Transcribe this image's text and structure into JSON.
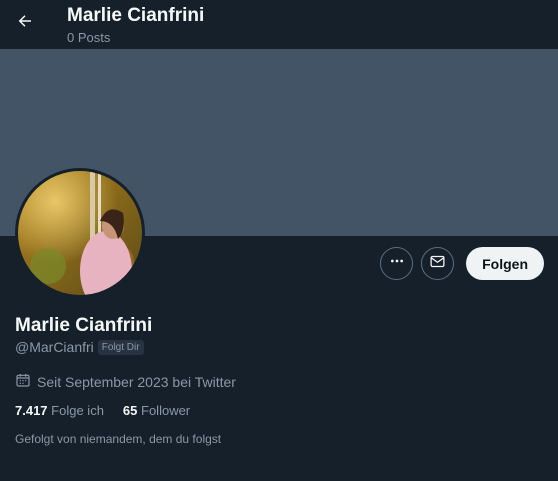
{
  "header": {
    "back_icon": "arrow-left-icon",
    "title": "Marlie Cianfrini",
    "subtitle": "0 Posts"
  },
  "colors": {
    "background": "#15202b",
    "banner": "#425466",
    "text_primary": "#f7f9f9",
    "text_secondary": "#8b98a5",
    "follow_button_bg": "#eff3f4"
  },
  "actions": {
    "more_icon": "more-horizontal-icon",
    "message_icon": "envelope-icon",
    "follow_label": "Folgen"
  },
  "profile": {
    "name": "Marlie Cianfrini",
    "handle": "@MarCianfri",
    "follows_you_badge": "Folgt Dir",
    "joined_icon": "calendar-icon",
    "joined": "Seit September 2023 bei Twitter",
    "following_count": "7.417",
    "following_label": "Folge ich",
    "followers_count": "65",
    "followers_label": "Follower",
    "followed_by": "Gefolgt von niemandem, dem du folgst"
  }
}
